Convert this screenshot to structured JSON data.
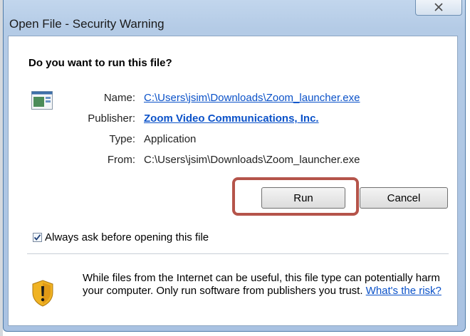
{
  "window": {
    "title": "Open File - Security Warning"
  },
  "question": "Do you want to run this file?",
  "details": {
    "name_label": "Name:",
    "name_value": "C:\\Users\\jsim\\Downloads\\Zoom_launcher.exe",
    "publisher_label": "Publisher:",
    "publisher_value": "Zoom Video Communications, Inc.",
    "type_label": "Type:",
    "type_value": "Application",
    "from_label": "From:",
    "from_value": "C:\\Users\\jsim\\Downloads\\Zoom_launcher.exe"
  },
  "buttons": {
    "run": "Run",
    "cancel": "Cancel"
  },
  "checkbox": {
    "label": "Always ask before opening this file",
    "checked": true
  },
  "warning": {
    "text": "While files from the Internet can be useful, this file type can potentially harm your computer. Only run software from publishers you trust.",
    "link": "What's the risk?"
  },
  "icons": {
    "close": "close-icon",
    "file": "application-file-icon",
    "shield": "warning-shield-icon",
    "check": "checkmark-icon"
  },
  "colors": {
    "link": "#0b52c9",
    "highlight": "#b5544a",
    "titlebar": "#b4cbe6"
  }
}
